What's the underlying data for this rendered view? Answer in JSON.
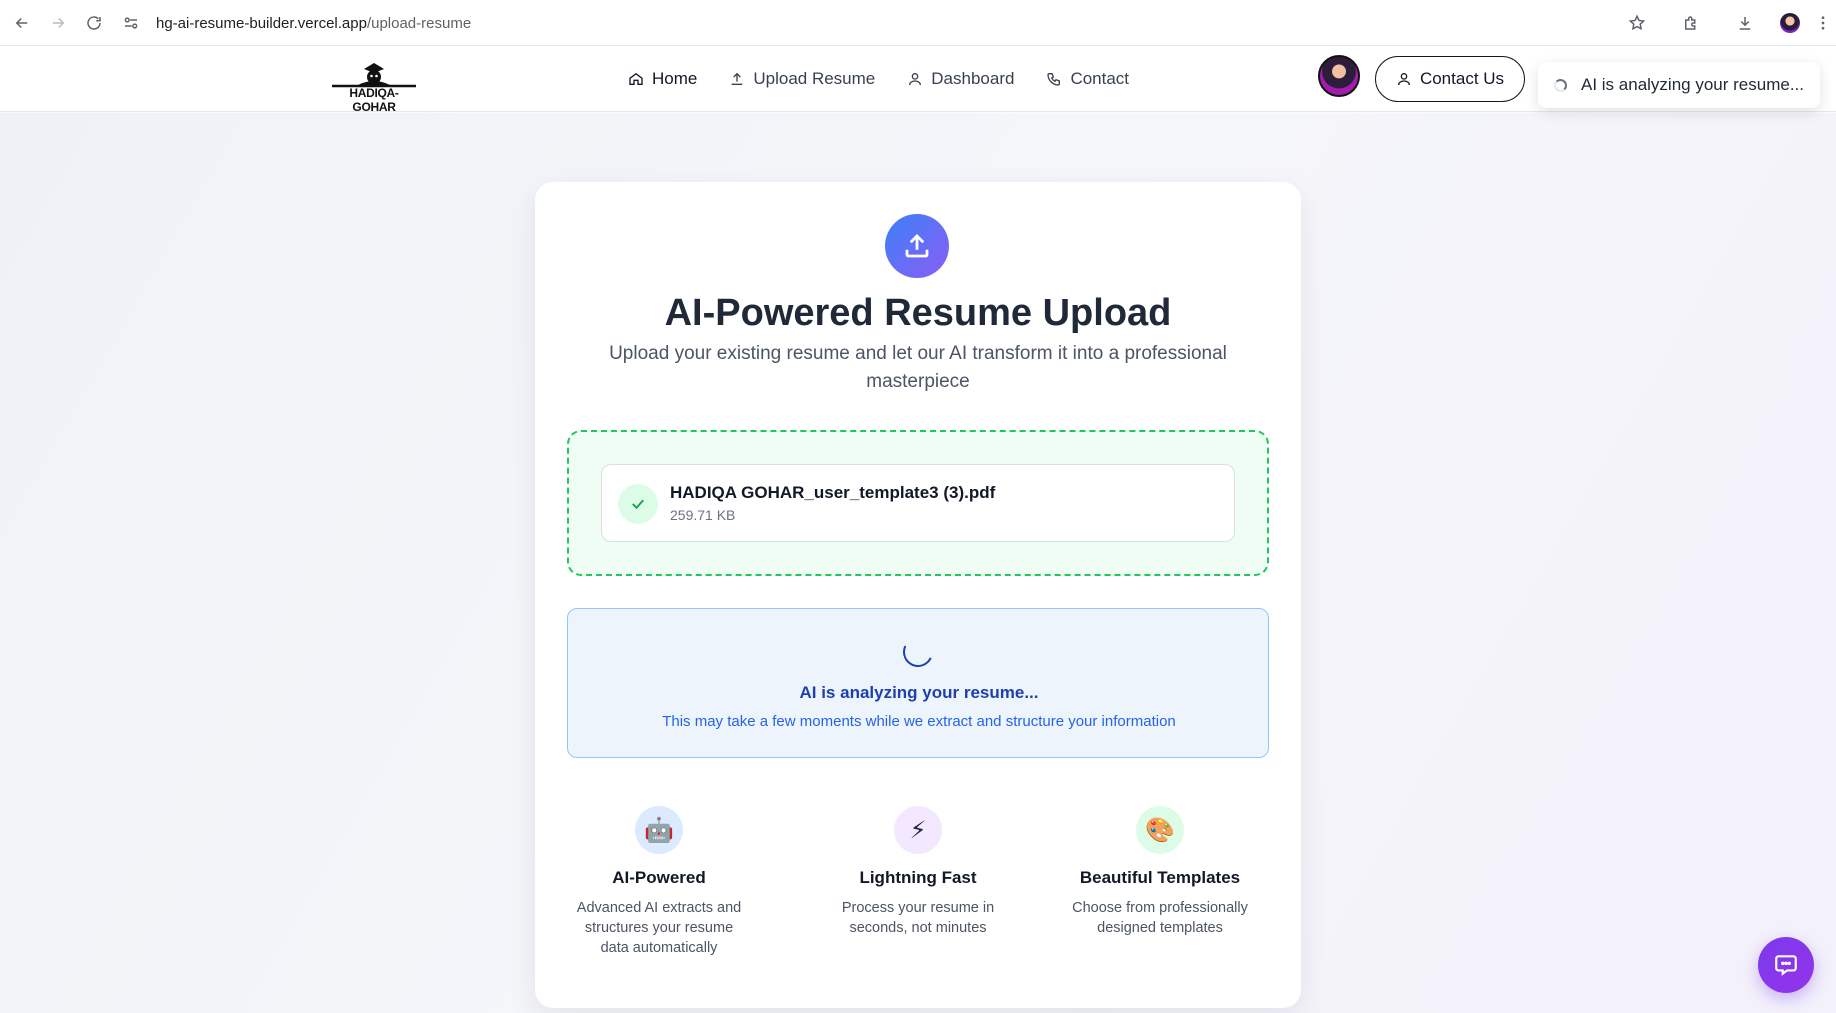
{
  "browser": {
    "url_domain": "hg-ai-resume-builder.vercel.app",
    "url_path": "/upload-resume"
  },
  "header": {
    "logo_text": "HADIQA-GOHAR",
    "nav": [
      {
        "label": "Home",
        "icon": "home-icon"
      },
      {
        "label": "Upload Resume",
        "icon": "upload-icon"
      },
      {
        "label": "Dashboard",
        "icon": "user-icon"
      },
      {
        "label": "Contact",
        "icon": "phone-icon"
      }
    ],
    "contact_button": "Contact Us"
  },
  "toast": {
    "text": "AI is analyzing your resume..."
  },
  "card": {
    "title": "AI-Powered Resume Upload",
    "subtitle": "Upload your existing resume and let our AI transform it into a professional masterpiece",
    "file": {
      "name": "HADIQA GOHAR_user_template3 (3).pdf",
      "size": "259.71 KB"
    },
    "analyzing": {
      "title": "AI is analyzing your resume...",
      "subtitle": "This may take a few moments while we extract and structure your information"
    },
    "features": [
      {
        "icon": "🤖",
        "title": "AI-Powered",
        "desc": "Advanced AI extracts and structures your resume data automatically"
      },
      {
        "icon": "⚡",
        "title": "Lightning Fast",
        "desc": "Process your resume in seconds, not minutes"
      },
      {
        "icon": "🎨",
        "title": "Beautiful Templates",
        "desc": "Choose from professionally designed templates"
      }
    ]
  },
  "colors": {
    "accent_blue": "#1e40af",
    "success_green": "#22c55e",
    "brand_purple": "#8b5cf6"
  }
}
